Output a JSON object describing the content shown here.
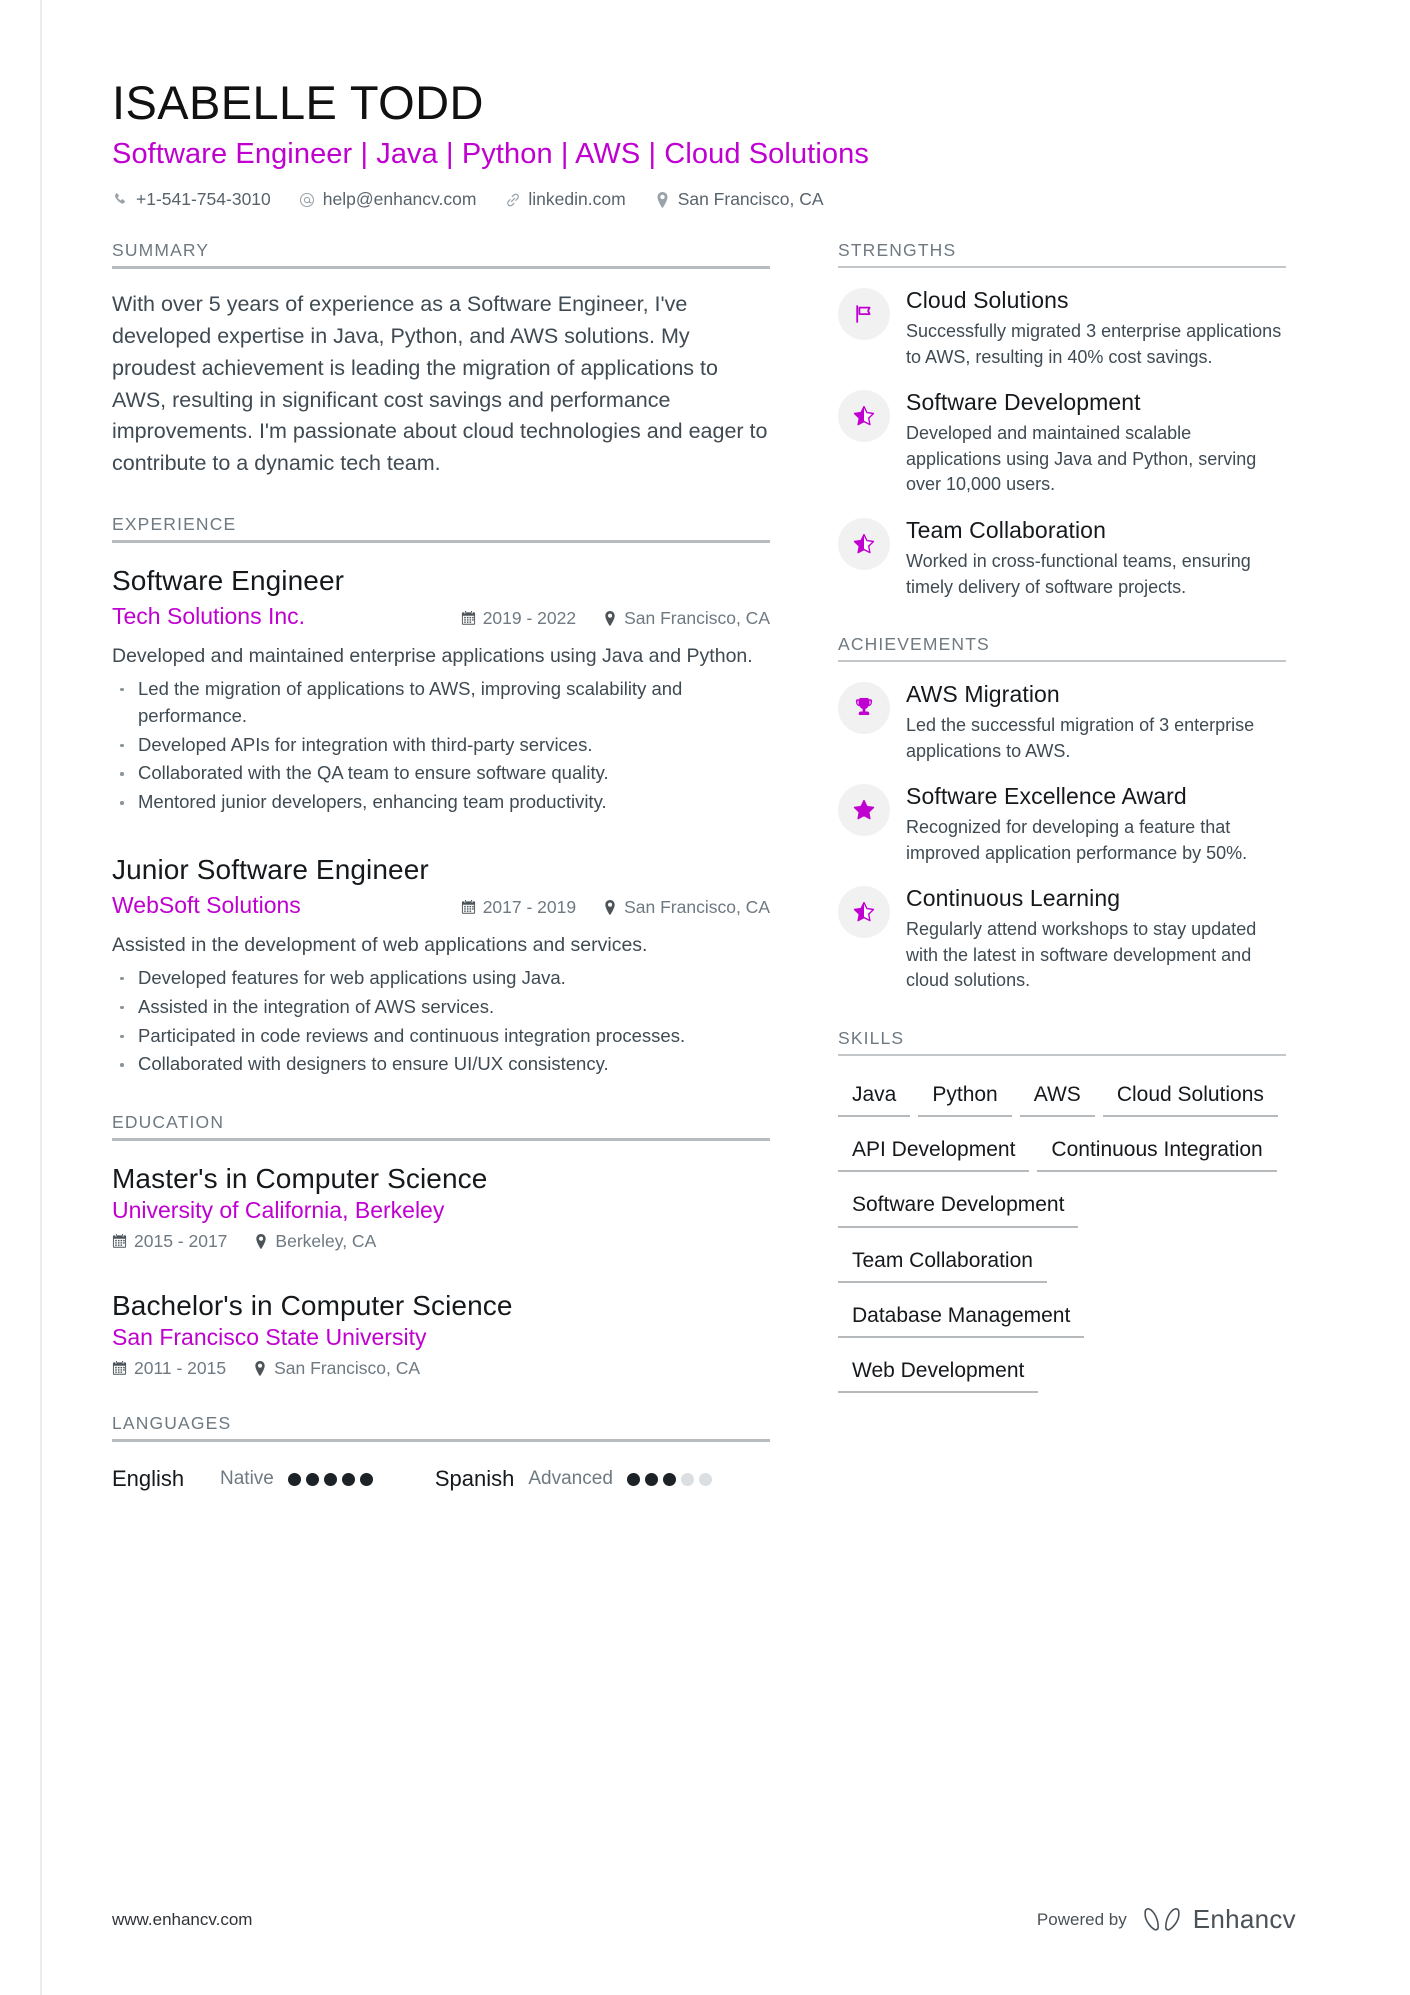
{
  "accent_color": "#bf00d0",
  "header": {
    "name": "ISABELLE TODD",
    "headline": "Software Engineer | Java | Python | AWS | Cloud Solutions",
    "contacts": [
      {
        "icon": "phone-icon",
        "text": "+1-541-754-3010"
      },
      {
        "icon": "email-icon",
        "text": "help@enhancv.com"
      },
      {
        "icon": "link-icon",
        "text": "linkedin.com"
      },
      {
        "icon": "location-icon",
        "text": "San Francisco, CA"
      }
    ]
  },
  "summary": {
    "title": "SUMMARY",
    "text": "With over 5 years of experience as a Software Engineer, I've developed expertise in Java, Python, and AWS solutions. My proudest achievement is leading the migration of applications to AWS, resulting in significant cost savings and performance improvements. I'm passionate about cloud technologies and eager to contribute to a dynamic tech team."
  },
  "experience": {
    "title": "EXPERIENCE",
    "entries": [
      {
        "role": "Software Engineer",
        "org": "Tech Solutions Inc.",
        "dates": "2019 - 2022",
        "location": "San Francisco, CA",
        "desc": "Developed and maintained enterprise applications using Java and Python.",
        "bullets": [
          "Led the migration of applications to AWS, improving scalability and performance.",
          "Developed APIs for integration with third-party services.",
          "Collaborated with the QA team to ensure software quality.",
          "Mentored junior developers, enhancing team productivity."
        ]
      },
      {
        "role": "Junior Software Engineer",
        "org": "WebSoft Solutions",
        "dates": "2017 - 2019",
        "location": "San Francisco, CA",
        "desc": "Assisted in the development of web applications and services.",
        "bullets": [
          "Developed features for web applications using Java.",
          "Assisted in the integration of AWS services.",
          "Participated in code reviews and continuous integration processes.",
          "Collaborated with designers to ensure UI/UX consistency."
        ]
      }
    ]
  },
  "education": {
    "title": "EDUCATION",
    "entries": [
      {
        "degree": "Master's in Computer Science",
        "school": "University of California, Berkeley",
        "dates": "2015 - 2017",
        "location": "Berkeley, CA"
      },
      {
        "degree": "Bachelor's in Computer Science",
        "school": "San Francisco State University",
        "dates": "2011 - 2015",
        "location": "San Francisco, CA"
      }
    ]
  },
  "languages": {
    "title": "LANGUAGES",
    "items": [
      {
        "name": "English",
        "level": "Native",
        "filled": 5,
        "total": 5
      },
      {
        "name": "Spanish",
        "level": "Advanced",
        "filled": 3,
        "total": 5
      }
    ]
  },
  "strengths": {
    "title": "STRENGTHS",
    "items": [
      {
        "icon": "flag-icon",
        "title": "Cloud Solutions",
        "desc": "Successfully migrated 3 enterprise applications to AWS, resulting in 40% cost savings."
      },
      {
        "icon": "half-star-icon",
        "title": "Software Development",
        "desc": "Developed and maintained scalable applications using Java and Python, serving over 10,000 users."
      },
      {
        "icon": "half-star-icon",
        "title": "Team Collaboration",
        "desc": "Worked in cross-functional teams, ensuring timely delivery of software projects."
      }
    ]
  },
  "achievements": {
    "title": "ACHIEVEMENTS",
    "items": [
      {
        "icon": "trophy-icon",
        "title": "AWS Migration",
        "desc": "Led the successful migration of 3 enterprise applications to AWS."
      },
      {
        "icon": "star-icon",
        "title": "Software Excellence Award",
        "desc": "Recognized for developing a feature that improved application performance by 50%."
      },
      {
        "icon": "half-star-icon",
        "title": "Continuous Learning",
        "desc": "Regularly attend workshops to stay updated with the latest in software development and cloud solutions."
      }
    ]
  },
  "skills": {
    "title": "SKILLS",
    "items": [
      "Java",
      "Python",
      "AWS",
      "Cloud Solutions",
      "API Development",
      "Continuous Integration",
      "Software Development",
      "Team Collaboration",
      "Database Management",
      "Web Development"
    ]
  },
  "footer": {
    "site": "www.enhancv.com",
    "powered_by": "Powered by",
    "brand": "Enhancv"
  }
}
